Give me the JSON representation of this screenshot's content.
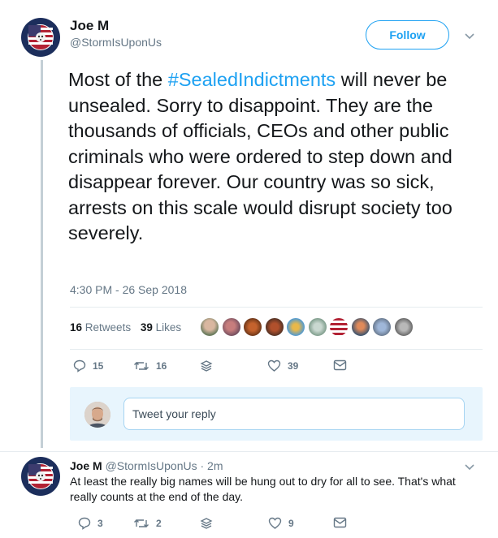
{
  "tweet": {
    "author_name": "Joe M",
    "author_handle": "@StormIsUponUs",
    "follow_label": "Follow",
    "text_before": "Most of the ",
    "hashtag": "#SealedIndictments",
    "text_after": " will never be unsealed. Sorry to disappoint. They are the thousands of officials, CEOs and other public criminals who were ordered to step down and disappear forever. Our country was so sick, arrests on this scale would disrupt society too severely.",
    "timestamp": "4:30 PM - 26 Sep 2018",
    "retweets_count": "16",
    "retweets_label": "Retweets",
    "likes_count": "39",
    "likes_label": "Likes",
    "actions": {
      "reply_count": "15",
      "retweet_count": "16",
      "like_count": "39"
    }
  },
  "reply_box": {
    "placeholder": "Tweet your reply"
  },
  "reply": {
    "author_name": "Joe M",
    "meta": "@StormIsUponUs · 2m",
    "text": "At least the really big names will be hung out to dry for all to see. That's what really counts at the end of the day.",
    "reply_count": "3",
    "retweet_count": "2",
    "like_count": "9"
  },
  "colors": {
    "accent": "#1da1f2",
    "secondary_text": "#657786",
    "divider": "#e6ecf0"
  },
  "icons": {
    "avatar": "made-in-usa-seal-icon",
    "reply": "speech-bubble-icon",
    "retweet": "retweet-arrows-icon",
    "dm": "layers-icon",
    "like": "heart-icon",
    "message": "envelope-icon",
    "menu": "chevron-down-icon"
  }
}
